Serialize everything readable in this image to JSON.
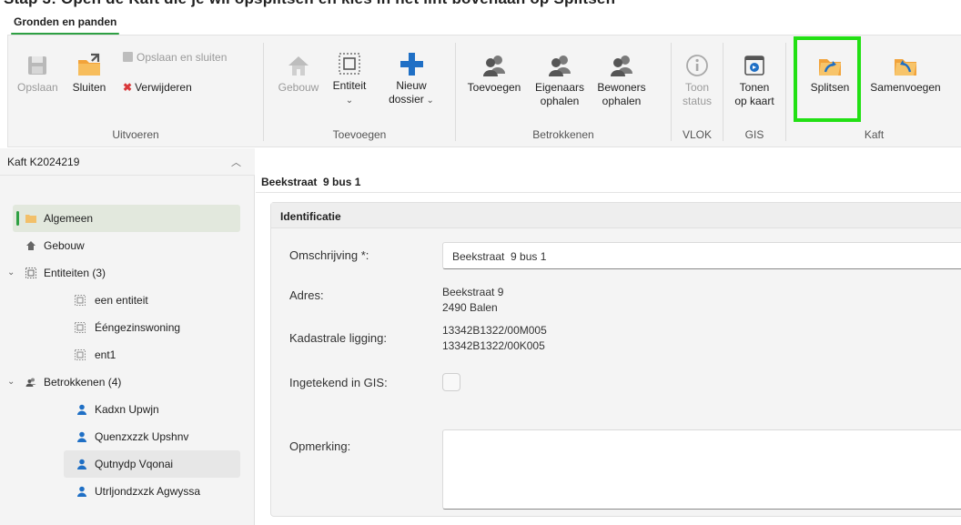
{
  "top_strip_text": "Stap 3: Open de Kaft die je wil opsplitsen en kies in het lint bovenaan op Splitsen",
  "ribbon": {
    "tab": "Gronden en panden",
    "groups": {
      "uitvoeren": {
        "label": "Uitvoeren",
        "opslaan": "Opslaan",
        "sluiten": "Sluiten",
        "opslaan_en_sluiten": "Opslaan en sluiten",
        "verwijderen": "Verwijderen"
      },
      "toevoegen": {
        "label": "Toevoegen",
        "gebouw": "Gebouw",
        "entiteit": "Entiteit",
        "nieuw_dossier_1": "Nieuw",
        "nieuw_dossier_2": "dossier"
      },
      "betrokkenen": {
        "label": "Betrokkenen",
        "toevoegen": "Toevoegen",
        "eigenaars_1": "Eigenaars",
        "eigenaars_2": "ophalen",
        "bewoners_1": "Bewoners",
        "bewoners_2": "ophalen"
      },
      "vlok": {
        "label": "VLOK",
        "toon_1": "Toon",
        "toon_2": "status"
      },
      "gis": {
        "label": "GIS",
        "tonen_1": "Tonen",
        "tonen_2": "op kaart"
      },
      "kaft": {
        "label": "Kaft",
        "splitsen": "Splitsen",
        "samenvoegen": "Samenvoegen"
      }
    }
  },
  "sidebar": {
    "title": "Kaft K2024219",
    "items": [
      {
        "label": "Algemeen"
      },
      {
        "label": "Gebouw"
      },
      {
        "label": "Entiteiten (3)"
      },
      {
        "label": "een entiteit"
      },
      {
        "label": "Ééngezinswoning"
      },
      {
        "label": "ent1"
      },
      {
        "label": "Betrokkenen (4)"
      },
      {
        "label": "Kadxn Upwjn"
      },
      {
        "label": "Quenzxzzk Upshnv"
      },
      {
        "label": "Qutnydp Vqonai"
      },
      {
        "label": "Utrljondzxzk Agwyssa"
      }
    ]
  },
  "main": {
    "title": "Beekstraat  9 bus 1",
    "section": "Identificatie",
    "fields": {
      "omschrijving_label": "Omschrijving *:",
      "omschrijving_value": "Beekstraat  9 bus 1",
      "adres_label": "Adres:",
      "adres_line1": "Beekstraat 9",
      "adres_line2": "2490 Balen",
      "kadastrale_label": "Kadastrale ligging:",
      "kadastrale_line1": "13342B1322/00M005",
      "kadastrale_line2": "13342B1322/00K005",
      "gis_label": "Ingetekend in GIS:",
      "opmerking_label": "Opmerking:",
      "gis_checked": false
    }
  },
  "colors": {
    "accent_green": "#2ea043",
    "highlight_green": "#22e014",
    "person_blue": "#1f6fc5",
    "folder_orange": "#f2a33a"
  }
}
